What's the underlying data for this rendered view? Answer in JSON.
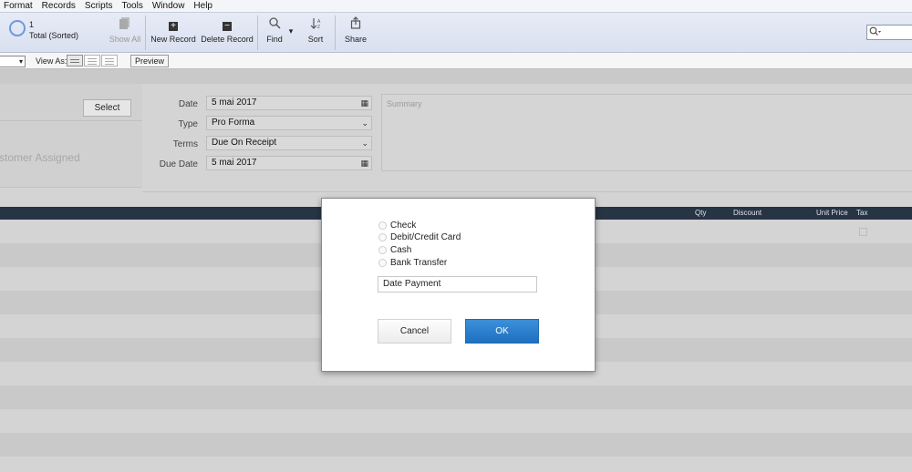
{
  "menu": [
    "Format",
    "Records",
    "Scripts",
    "Tools",
    "Window",
    "Help"
  ],
  "toolbar": {
    "record_number": "1",
    "record_total": "Total (Sorted)",
    "show_all": "Show All",
    "new_record": "New Record",
    "delete_record": "Delete Record",
    "find": "Find",
    "sort": "Sort",
    "share": "Share"
  },
  "layoutbar": {
    "view_as": "View As:",
    "preview": "Preview"
  },
  "left_panel": {
    "select_label": "Select",
    "customer_placeholder": "stomer Assigned"
  },
  "form": {
    "date_label": "Date",
    "date_value": "5 mai 2017",
    "type_label": "Type",
    "type_value": "Pro Forma",
    "terms_label": "Terms",
    "terms_value": "Due On Receipt",
    "due_date_label": "Due Date",
    "due_date_value": "5 mai 2017",
    "summary_placeholder": "Summary"
  },
  "table": {
    "headers": {
      "qty": "Qty",
      "discount": "Discount",
      "unit_price": "Unit Price",
      "tax": "Tax"
    },
    "row_count": 11
  },
  "dialog": {
    "options": [
      "Check",
      "Debit/Credit Card",
      "Cash",
      "Bank Transfer"
    ],
    "date_input_value": "Date Payment",
    "cancel": "Cancel",
    "ok": "OK"
  },
  "colors": {
    "ok_button": "#2a7bcc",
    "table_header": "#263444",
    "toolbar": "#dde3f1"
  }
}
